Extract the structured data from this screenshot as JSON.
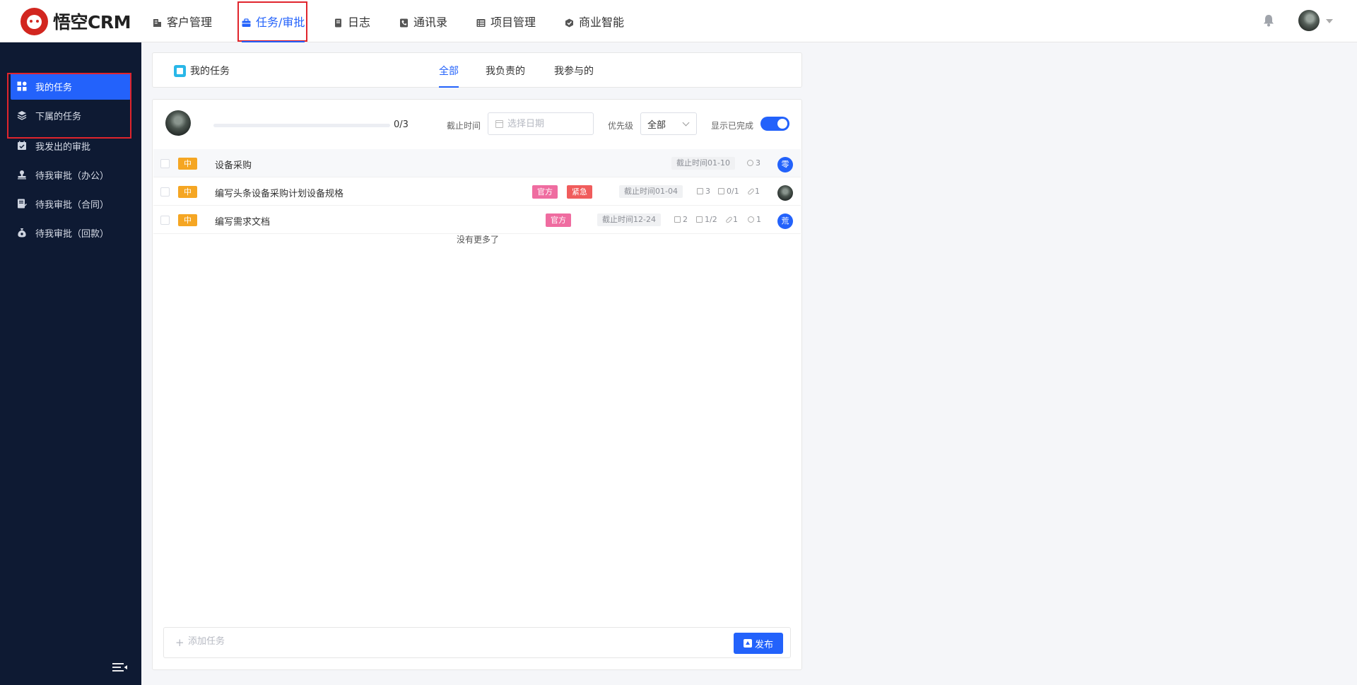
{
  "app": {
    "logo_text": "悟空CRM",
    "brand_color": "#d2261f",
    "accent_color": "#2362fb"
  },
  "topnav": {
    "items": [
      {
        "label": "客户管理",
        "icon": "building-icon"
      },
      {
        "label": "任务/审批",
        "icon": "briefcase-icon",
        "active": true
      },
      {
        "label": "日志",
        "icon": "journal-icon"
      },
      {
        "label": "通讯录",
        "icon": "contacts-icon"
      },
      {
        "label": "项目管理",
        "icon": "project-icon"
      },
      {
        "label": "商业智能",
        "icon": "bi-icon"
      }
    ],
    "right_icons": [
      "bell-icon",
      "user-avatar",
      "caret-down-icon"
    ]
  },
  "sidebar": {
    "items": [
      {
        "label": "我的任务",
        "icon": "grid-icon",
        "active": true
      },
      {
        "label": "下属的任务",
        "icon": "layers-icon"
      },
      {
        "label": "我发出的审批",
        "icon": "calendar-check-icon"
      },
      {
        "label": "待我审批（办公）",
        "icon": "stamp-icon"
      },
      {
        "label": "待我审批（合同）",
        "icon": "contract-icon"
      },
      {
        "label": "待我审批（回款）",
        "icon": "money-bag-icon"
      }
    ],
    "collapse_icon": "collapse-menu-icon"
  },
  "header": {
    "title": "我的任务",
    "tabs": [
      {
        "label": "全部",
        "active": true
      },
      {
        "label": "我负责的"
      },
      {
        "label": "我参与的"
      }
    ]
  },
  "toolbar": {
    "progress_text": "0/3",
    "progress_fraction": 0,
    "deadline_label": "截止时间",
    "date_placeholder": "选择日期",
    "priority_label": "优先级",
    "priority_value": "全部",
    "show_completed_label": "显示已完成",
    "show_completed": true
  },
  "tasks": [
    {
      "priority": "中",
      "name": "设备采购",
      "tags": [],
      "due": "截止时间01-10",
      "comments": "3",
      "assignee": "零"
    },
    {
      "priority": "中",
      "name": "编写头条设备采购计划设备规格",
      "tags": [
        "官方",
        "紧急"
      ],
      "due": "截止时间01-04",
      "files": "3",
      "subtasks": "0/1",
      "attachments": "1",
      "assignee_photo": true
    },
    {
      "priority": "中",
      "name": "编写需求文档",
      "tags": [
        "官方"
      ],
      "due": "截止时间12-24",
      "files": "2",
      "subtasks": "1/2",
      "attachments": "1",
      "comments": "1",
      "assignee": "荒"
    }
  ],
  "no_more_text": "没有更多了",
  "add_task": {
    "placeholder": "添加任务",
    "publish_label": "发布"
  }
}
